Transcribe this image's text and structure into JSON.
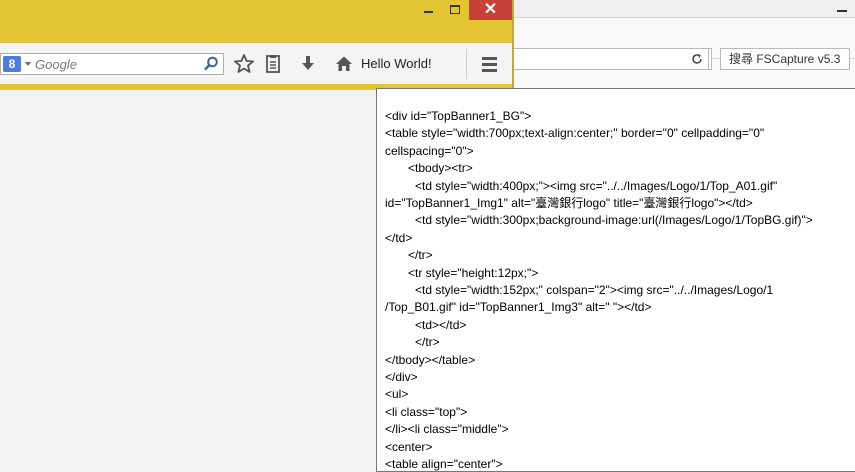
{
  "background_window": {
    "reload_icon": "reload-icon",
    "search_text": "搜尋 FSCapture v5.3"
  },
  "firefox": {
    "controls": {
      "minimize": "",
      "maximize": "",
      "close": "✕"
    },
    "search": {
      "engine_icon": "google-icon",
      "placeholder": "Google"
    },
    "toolbar": {
      "hello_world_label": "Hello World!"
    },
    "icons": [
      "search-icon",
      "star-icon",
      "clipboard-icon",
      "download-icon",
      "home-icon",
      "hamburger-menu-icon"
    ],
    "accent_color": "#e3c432",
    "close_color": "#c7403a"
  },
  "code_popup": {
    "lines": [
      {
        "indent": 0,
        "text": "  <div id=\"TopBanner1_BG\">"
      },
      {
        "indent": 0,
        "text": "<table style=\"width:700px;text-align:center;\" border=\"0\" cellpadding=\"0\""
      },
      {
        "indent": 0,
        "text": "cellspacing=\"0\">"
      },
      {
        "indent": 1,
        "text": "<tbody><tr>"
      },
      {
        "indent": 2,
        "text": "<td style=\"width:400px;\"><img src=\"../../Images/Logo/1/Top_A01.gif\""
      },
      {
        "indent": 0,
        "text": "id=\"TopBanner1_Img1\" alt=\"臺灣銀行logo\" title=\"臺灣銀行logo\"></td>"
      },
      {
        "indent": 2,
        "text": "<td style=\"width:300px;background-image:url(/Images/Logo/1/TopBG.gif)\">"
      },
      {
        "indent": 0,
        "text": "</td>"
      },
      {
        "indent": 1,
        "text": "</tr>"
      },
      {
        "indent": 1,
        "text": "<tr style=\"height:12px;\">"
      },
      {
        "indent": 2,
        "text": "<td style=\"width:152px;\" colspan=\"2\"><img src=\"../../Images/Logo/1"
      },
      {
        "indent": 0,
        "text": "/Top_B01.gif\" id=\"TopBanner1_Img3\" alt=\" \"></td>"
      },
      {
        "indent": 2,
        "text": "<td></td>"
      },
      {
        "indent": 2,
        "text": "</tr>"
      },
      {
        "indent": 0,
        "text": "</tbody></table>"
      },
      {
        "indent": 0,
        "text": "</div>"
      },
      {
        "indent": 0,
        "text": "  <ul>"
      },
      {
        "indent": 0,
        "text": "   <li class=\"top\">"
      },
      {
        "indent": 0,
        "text": "   </li><li class=\"middle\">"
      },
      {
        "indent": 0,
        "text": "    <center>"
      },
      {
        "indent": 0,
        "text": "    <table align=\"center\">"
      }
    ]
  }
}
